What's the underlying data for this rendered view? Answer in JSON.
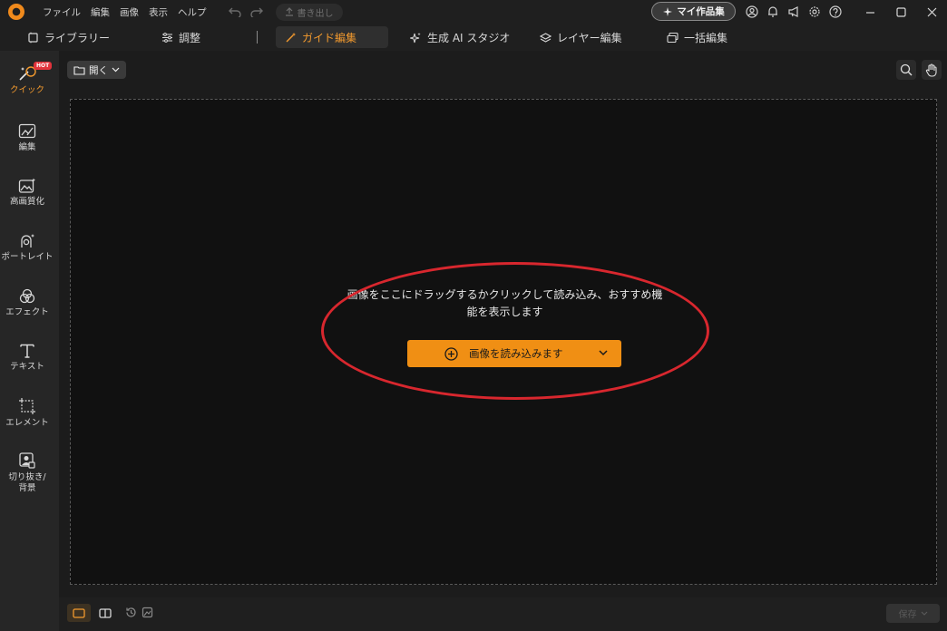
{
  "titlebar": {
    "menu": [
      "ファイル",
      "編集",
      "画像",
      "表示",
      "ヘルプ"
    ],
    "export_label": "書き出し",
    "my_works_label": "マイ作品集"
  },
  "tabs": [
    {
      "label": "ライブラリー",
      "icon": "library-icon"
    },
    {
      "label": "調整",
      "icon": "sliders-icon"
    },
    {
      "label": "ガイド編集",
      "icon": "magic-wand-icon",
      "active": true
    },
    {
      "label": "生成 AI スタジオ",
      "icon": "sparkle-icon"
    },
    {
      "label": "レイヤー編集",
      "icon": "layers-icon"
    },
    {
      "label": "一括編集",
      "icon": "batch-icon"
    }
  ],
  "sidebar": {
    "hot_badge": "HOT",
    "items": [
      {
        "label": "クイック",
        "icon": "quick-magic-icon",
        "active": true
      },
      {
        "label": "編集",
        "icon": "image-edit-icon"
      },
      {
        "label": "高画質化",
        "icon": "image-enhance-icon"
      },
      {
        "label": "ポートレイト",
        "icon": "portrait-icon"
      },
      {
        "label": "エフェクト",
        "icon": "effects-icon"
      },
      {
        "label": "テキスト",
        "icon": "text-icon"
      },
      {
        "label": "エレメント",
        "icon": "element-icon"
      },
      {
        "label": "切り抜き/\n背景",
        "icon": "cutout-background-icon"
      }
    ]
  },
  "toolbar": {
    "open_label": "開く"
  },
  "canvas": {
    "drop_text": "画像をここにドラッグするかクリックして読み込み、おすすめ機能を表示します",
    "load_button_label": "画像を読み込みます"
  },
  "bottombar": {
    "save_label": "保存"
  },
  "colors": {
    "accent": "#f08f14",
    "highlight_oval": "#d8272e",
    "background": "#111111"
  }
}
